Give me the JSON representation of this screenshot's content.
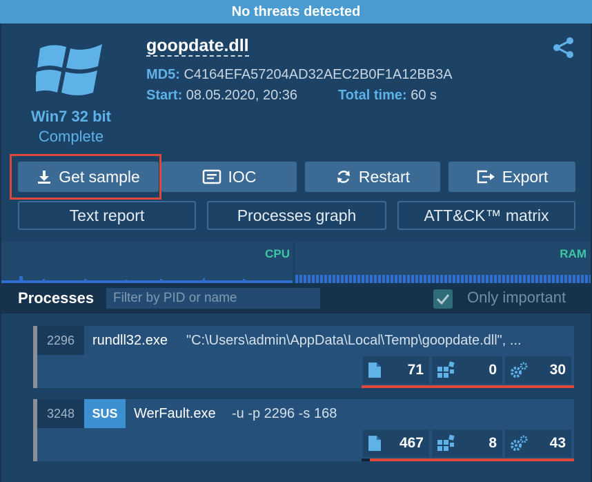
{
  "banner": "No threats detected",
  "os": {
    "name": "Win7 32 bit",
    "status": "Complete",
    "icon": "windows-logo-icon"
  },
  "file": {
    "name": "goopdate.dll",
    "md5_label": "MD5:",
    "md5": "C4164EFA57204AD32AEC2B0F1A12BB3A",
    "start_label": "Start:",
    "start": "08.05.2020, 20:36",
    "total_label": "Total time:",
    "total": "60 s"
  },
  "actions": {
    "get_sample": "Get sample",
    "ioc": "IOC",
    "restart": "Restart",
    "export": "Export",
    "text_report": "Text report",
    "processes_graph": "Processes graph",
    "attck": "ATT&CK™ matrix"
  },
  "graphs": {
    "cpu": "CPU",
    "ram": "RAM"
  },
  "processes": {
    "title": "Processes",
    "filter_placeholder": "Filter by PID or name",
    "only_important": "Only important",
    "only_important_checked": true,
    "items": [
      {
        "pid": "2296",
        "name": "rundll32.exe",
        "cmd": "\"C:\\Users\\admin\\AppData\\Local\\Temp\\goopdate.dll\", ...",
        "files": "71",
        "modules": "0",
        "settings": "30"
      },
      {
        "pid": "3248",
        "badge": "SUS",
        "name": "WerFault.exe",
        "cmd": "-u -p 2296 -s 168",
        "files": "467",
        "modules": "8",
        "settings": "43"
      }
    ]
  },
  "colors": {
    "accent": "#4a9bd2",
    "panel": "#1c4266",
    "button": "#3b6a95",
    "highlight": "#e0483a",
    "graph": "#3dc7a5"
  }
}
